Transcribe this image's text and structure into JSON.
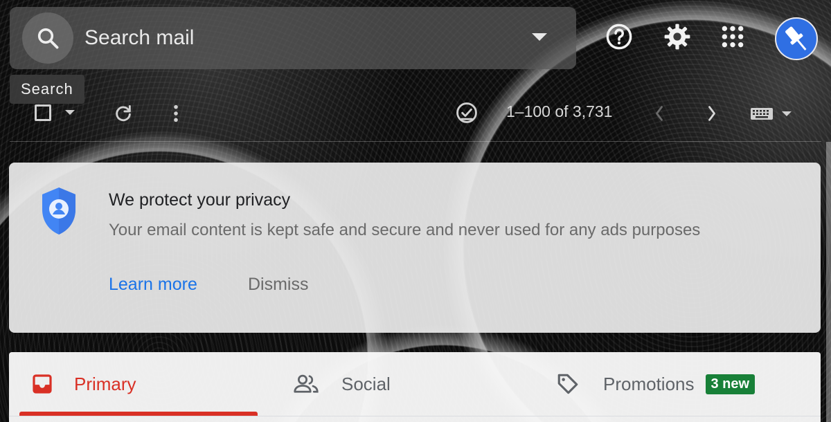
{
  "header": {
    "search_placeholder": "Search mail",
    "search_tooltip": "Search",
    "icons": [
      "search-icon",
      "chevron-down-icon",
      "help-icon",
      "gear-icon",
      "apps-grid-icon",
      "avatar"
    ]
  },
  "toolbar": {
    "page_count": "1–100 of 3,731",
    "icons": [
      "select-checkbox",
      "refresh-icon",
      "more-vert-icon",
      "task-check-icon",
      "chevron-left-icon",
      "chevron-right-icon",
      "keyboard-icon"
    ]
  },
  "privacy_card": {
    "title": "We protect your privacy",
    "body": "Your email content is kept safe and secure and never used for any ads purposes",
    "learn_more": "Learn more",
    "dismiss": "Dismiss"
  },
  "tabs": [
    {
      "label": "Primary",
      "active": true,
      "color": "#d93025"
    },
    {
      "label": "Social",
      "active": false
    },
    {
      "label": "Promotions",
      "active": false,
      "badge": "3 new",
      "badge_color": "#188038"
    }
  ],
  "colors": {
    "link": "#1a73e8",
    "accent_red": "#d93025",
    "avatar_blue": "#2f6fe3"
  }
}
